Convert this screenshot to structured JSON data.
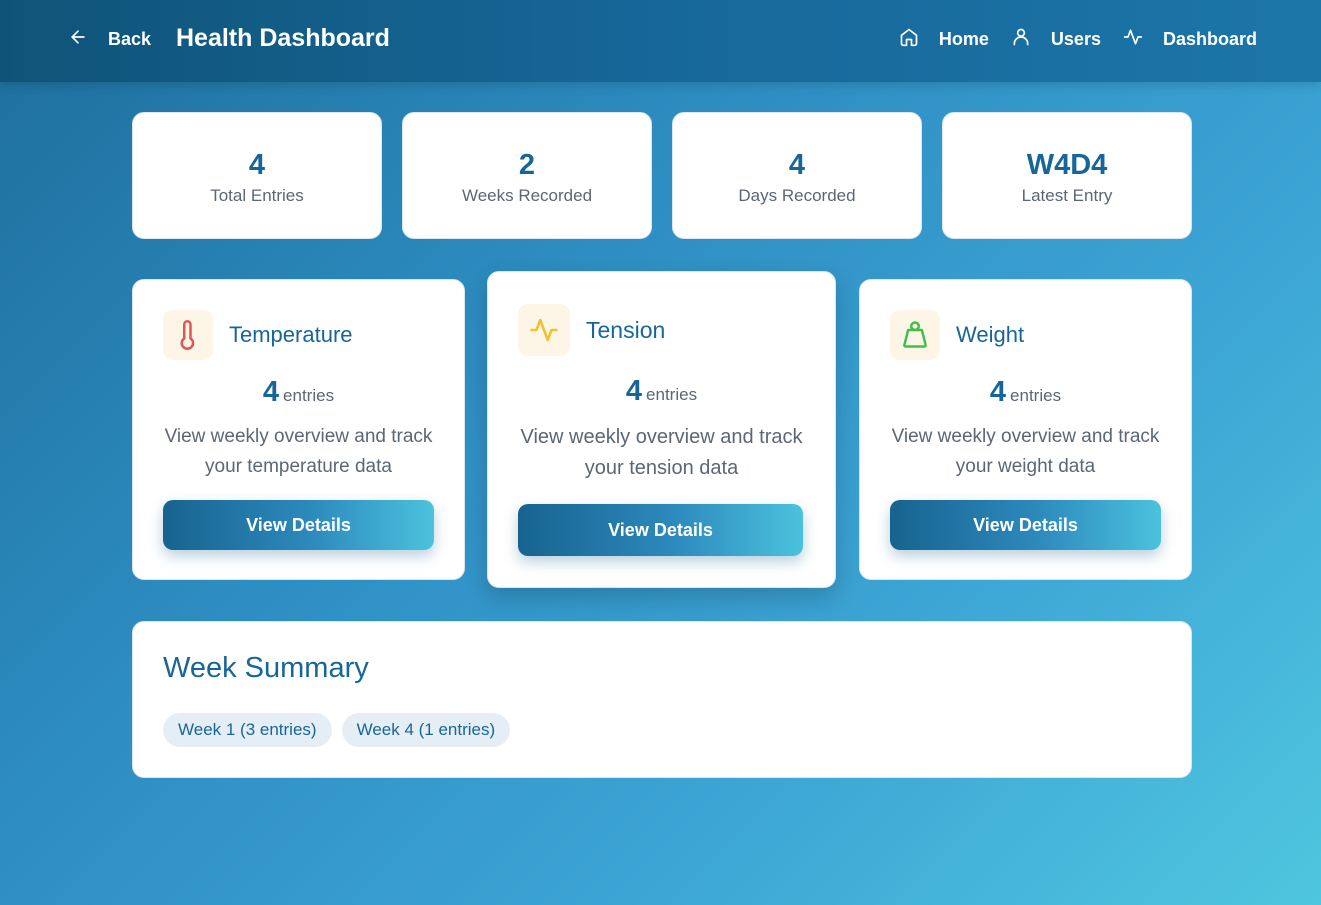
{
  "header": {
    "back_label": "Back",
    "title": "Health Dashboard",
    "nav": [
      {
        "label": "Home",
        "icon": "home-icon"
      },
      {
        "label": "Users",
        "icon": "user-icon"
      },
      {
        "label": "Dashboard",
        "icon": "activity-icon"
      }
    ]
  },
  "stats": [
    {
      "value": "4",
      "label": "Total Entries"
    },
    {
      "value": "2",
      "label": "Weeks Recorded"
    },
    {
      "value": "4",
      "label": "Days Recorded"
    },
    {
      "value": "W4D4",
      "label": "Latest Entry"
    }
  ],
  "metrics": [
    {
      "title": "Temperature",
      "icon": "thermometer-icon",
      "count": "4",
      "unit": "entries",
      "description": "View weekly overview and track your temperature data",
      "button": "View Details",
      "icon_color": "#e05555"
    },
    {
      "title": "Tension",
      "icon": "activity-icon",
      "count": "4",
      "unit": "entries",
      "description": "View weekly overview and track your tension data",
      "button": "View Details",
      "icon_color": "#f2c12e"
    },
    {
      "title": "Weight",
      "icon": "weight-icon",
      "count": "4",
      "unit": "entries",
      "description": "View weekly overview and track your weight data",
      "button": "View Details",
      "icon_color": "#3fbf4a"
    }
  ],
  "summary": {
    "title": "Week Summary",
    "weeks": [
      {
        "label": "Week 1 (3 entries)"
      },
      {
        "label": "Week 4 (1 entries)"
      }
    ]
  },
  "colors": {
    "accent": "#17669a",
    "header": "#135f8a"
  }
}
